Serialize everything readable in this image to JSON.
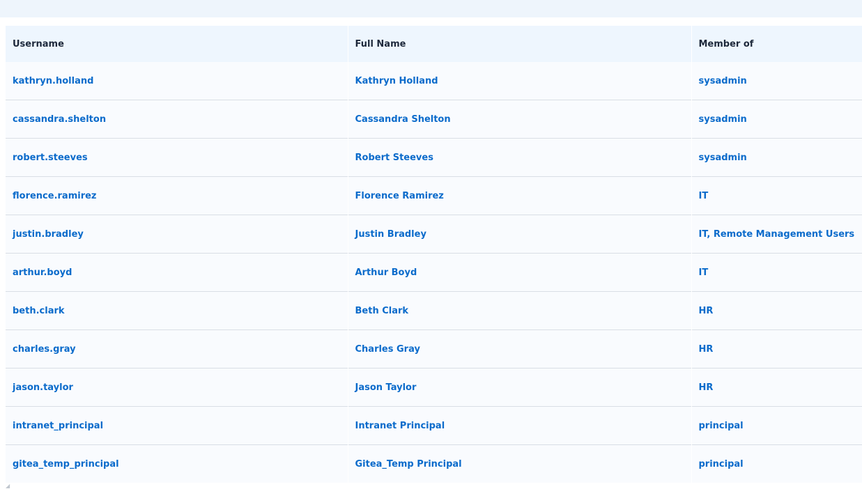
{
  "table": {
    "headers": {
      "username": "Username",
      "full_name": "Full Name",
      "member_of": "Member of"
    },
    "rows": [
      {
        "username": "kathryn.holland",
        "full_name": "Kathryn Holland",
        "member_of": "sysadmin"
      },
      {
        "username": "cassandra.shelton",
        "full_name": "Cassandra Shelton",
        "member_of": "sysadmin"
      },
      {
        "username": "robert.steeves",
        "full_name": "Robert Steeves",
        "member_of": "sysadmin"
      },
      {
        "username": "florence.ramirez",
        "full_name": "Florence Ramirez",
        "member_of": "IT"
      },
      {
        "username": "justin.bradley",
        "full_name": "Justin Bradley",
        "member_of": "IT, Remote Management Users"
      },
      {
        "username": "arthur.boyd",
        "full_name": "Arthur Boyd",
        "member_of": "IT"
      },
      {
        "username": "beth.clark",
        "full_name": "Beth Clark",
        "member_of": "HR"
      },
      {
        "username": "charles.gray",
        "full_name": "Charles Gray",
        "member_of": "HR"
      },
      {
        "username": "jason.taylor",
        "full_name": "Jason Taylor",
        "member_of": "HR"
      },
      {
        "username": "intranet_principal",
        "full_name": "Intranet Principal",
        "member_of": "principal"
      },
      {
        "username": "gitea_temp_principal",
        "full_name": "Gitea_Temp Principal",
        "member_of": "principal"
      }
    ]
  },
  "colors": {
    "link": "#0b6bcb",
    "header_bg": "#eef6fe",
    "row_bg": "#f9fbfe",
    "row_border": "#d9dee5"
  },
  "icons": {
    "resize_grip": "resize-grip-icon"
  }
}
